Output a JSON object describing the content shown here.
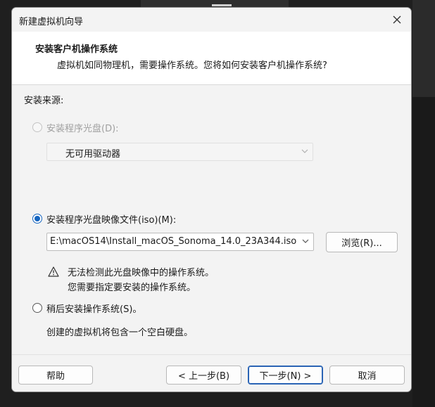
{
  "window": {
    "title": "新建虚拟机向导",
    "close_icon": "close-icon"
  },
  "header": {
    "title": "安装客户机操作系统",
    "subtitle": "虚拟机如同物理机，需要操作系统。您将如何安装客户机操作系统?"
  },
  "install_source": {
    "label": "安装来源:",
    "options": [
      {
        "label": "安装程序光盘(D):",
        "selected": false,
        "enabled": false,
        "dropdown_value": "无可用驱动器"
      },
      {
        "label": "安装程序光盘映像文件(iso)(M):",
        "selected": true,
        "enabled": true,
        "dropdown_value": "E:\\macOS14\\Install_macOS_Sonoma_14.0_23A344.iso",
        "browse_label": "浏览(R)...",
        "warning_line1": "无法检测此光盘映像中的操作系统。",
        "warning_line2": "您需要指定要安装的操作系统。"
      },
      {
        "label": "稍后安装操作系统(S)。",
        "selected": false,
        "enabled": true,
        "description": "创建的虚拟机将包含一个空白硬盘。"
      }
    ]
  },
  "footer": {
    "help_label": "帮助",
    "back_label": "< 上一步(B)",
    "next_label": "下一步(N) >",
    "cancel_label": "取消"
  },
  "colors": {
    "accent": "#1565c0",
    "dialog_bg": "#f3f3f3",
    "header_bg": "#ffffff",
    "backdrop": "#1f1f1f"
  }
}
